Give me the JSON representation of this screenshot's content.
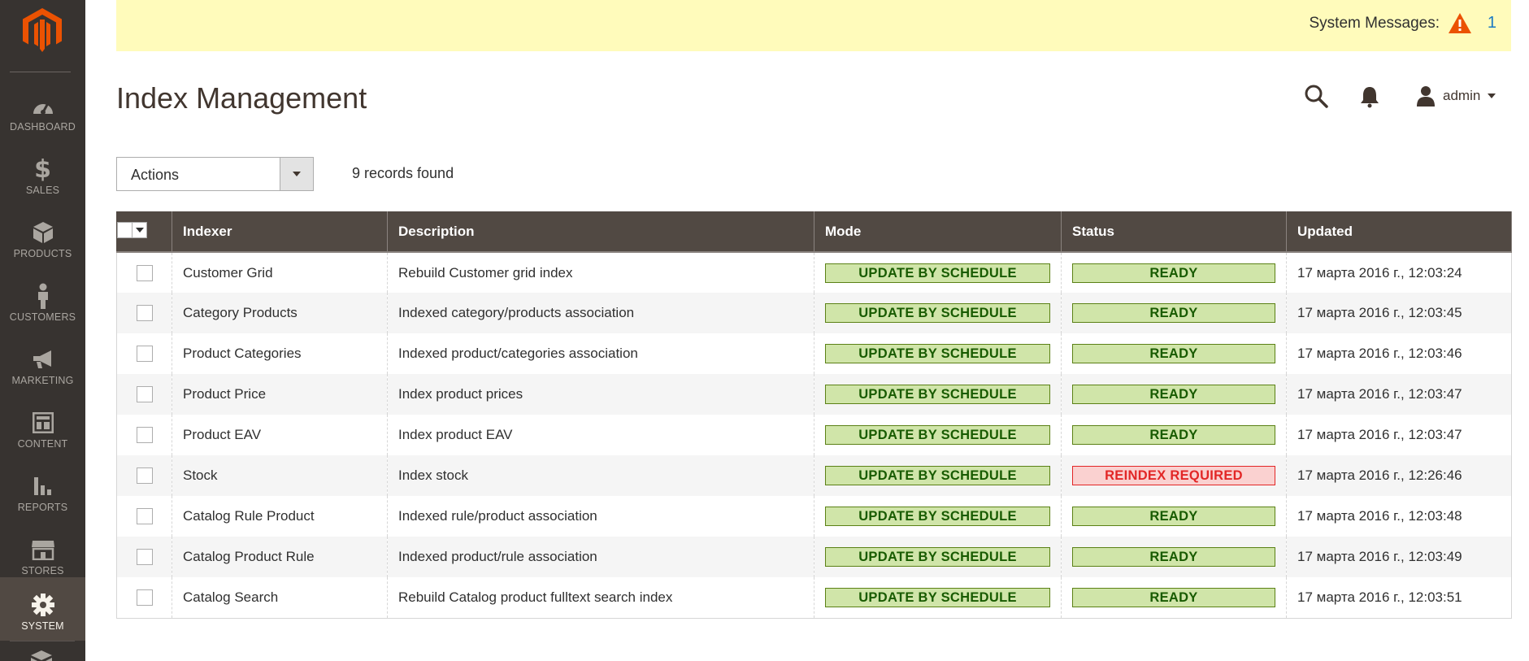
{
  "sidebar": {
    "logo": "magento-logo",
    "items": [
      {
        "label": "DASHBOARD",
        "icon": "dashboard-icon"
      },
      {
        "label": "SALES",
        "icon": "dollar-icon"
      },
      {
        "label": "PRODUCTS",
        "icon": "box-icon"
      },
      {
        "label": "CUSTOMERS",
        "icon": "person-icon"
      },
      {
        "label": "MARKETING",
        "icon": "megaphone-icon"
      },
      {
        "label": "CONTENT",
        "icon": "layout-icon"
      },
      {
        "label": "REPORTS",
        "icon": "bar-chart-icon"
      },
      {
        "label": "STORES",
        "icon": "store-icon"
      },
      {
        "label": "SYSTEM",
        "icon": "gear-icon",
        "active": true
      }
    ]
  },
  "system_messages": {
    "label": "System Messages:",
    "count": "1",
    "icon": "warning-icon",
    "color": "#eb5202"
  },
  "header": {
    "title": "Index Management",
    "user": "admin"
  },
  "toolbar": {
    "actions_label": "Actions",
    "records_found": "9 records found"
  },
  "grid": {
    "columns": [
      "Indexer",
      "Description",
      "Mode",
      "Status",
      "Updated"
    ],
    "rows": [
      {
        "indexer": "Customer Grid",
        "description": "Rebuild Customer grid index",
        "mode": "UPDATE BY SCHEDULE",
        "status": "READY",
        "updated": "17 марта 2016 г., 12:03:24"
      },
      {
        "indexer": "Category Products",
        "description": "Indexed category/products association",
        "mode": "UPDATE BY SCHEDULE",
        "status": "READY",
        "updated": "17 марта 2016 г., 12:03:45"
      },
      {
        "indexer": "Product Categories",
        "description": "Indexed product/categories association",
        "mode": "UPDATE BY SCHEDULE",
        "status": "READY",
        "updated": "17 марта 2016 г., 12:03:46"
      },
      {
        "indexer": "Product Price",
        "description": "Index product prices",
        "mode": "UPDATE BY SCHEDULE",
        "status": "READY",
        "updated": "17 марта 2016 г., 12:03:47"
      },
      {
        "indexer": "Product EAV",
        "description": "Index product EAV",
        "mode": "UPDATE BY SCHEDULE",
        "status": "READY",
        "updated": "17 марта 2016 г., 12:03:47"
      },
      {
        "indexer": "Stock",
        "description": "Index stock",
        "mode": "UPDATE BY SCHEDULE",
        "status": "REINDEX REQUIRED",
        "updated": "17 марта 2016 г., 12:26:46"
      },
      {
        "indexer": "Catalog Rule Product",
        "description": "Indexed rule/product association",
        "mode": "UPDATE BY SCHEDULE",
        "status": "READY",
        "updated": "17 марта 2016 г., 12:03:48"
      },
      {
        "indexer": "Catalog Product Rule",
        "description": "Indexed product/rule association",
        "mode": "UPDATE BY SCHEDULE",
        "status": "READY",
        "updated": "17 марта 2016 г., 12:03:49"
      },
      {
        "indexer": "Catalog Search",
        "description": "Rebuild Catalog product fulltext search index",
        "mode": "UPDATE BY SCHEDULE",
        "status": "READY",
        "updated": "17 марта 2016 г., 12:03:51"
      }
    ]
  },
  "colors": {
    "sidebar_bg": "#373330",
    "header_bg": "#514943",
    "ready_bg": "#d0e5a9",
    "ready_text": "#185b00",
    "error_bg": "#fad1d0",
    "error_text": "#e22626",
    "accent": "#eb5202"
  }
}
